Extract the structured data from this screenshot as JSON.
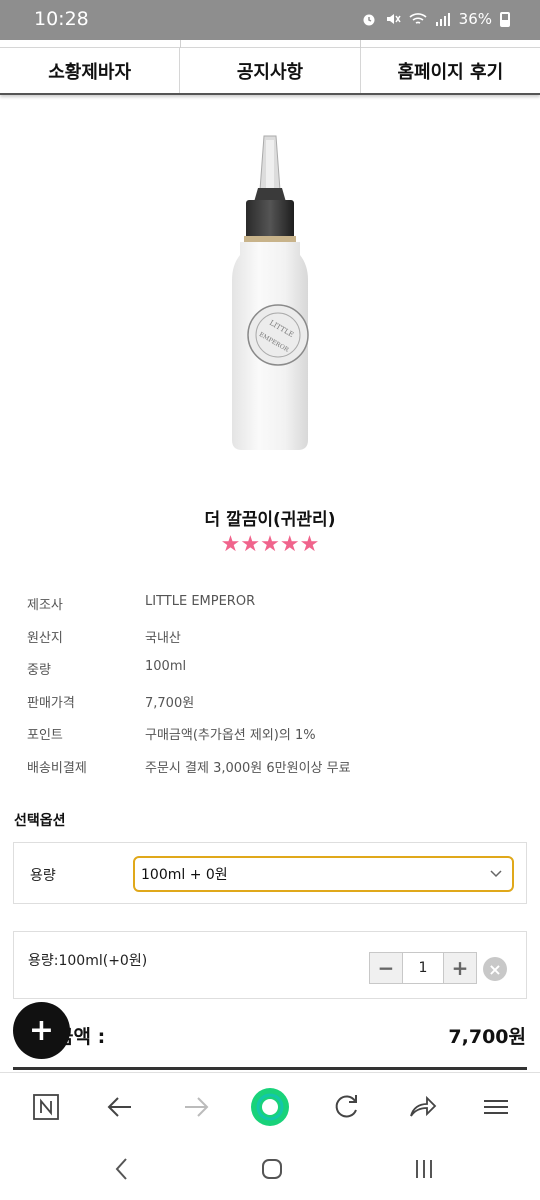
{
  "status": {
    "time": "10:28",
    "battery": "36%"
  },
  "nav": {
    "tabs": [
      "소황제바자",
      "공지사항",
      "홈페이지 후기"
    ]
  },
  "product": {
    "name": "더 깔끔이(귀관리)",
    "rating": 5,
    "bottle_label": "LITTLE EMPEROR",
    "info": [
      {
        "label": "제조사",
        "value": "LITTLE EMPEROR"
      },
      {
        "label": "원산지",
        "value": "국내산"
      },
      {
        "label": "중량",
        "value": "100ml"
      },
      {
        "label": "판매가격",
        "value": "7,700원"
      },
      {
        "label": "포인트",
        "value": "구매금액(추가옵션 제외)의 1%"
      },
      {
        "label": "배송비결제",
        "value": "주문시 결제 3,000원 6만원이상 무료"
      }
    ]
  },
  "options": {
    "title": "선택옵션",
    "label": "용량",
    "selected": "100ml  + 0원",
    "accent": "#e0a81a"
  },
  "cart_item": {
    "label": "용량:100ml(+0원)",
    "quantity": "1",
    "minus": "−",
    "plus": "+",
    "remove": "×"
  },
  "total": {
    "label": "금액 :",
    "value": "7,700원"
  },
  "fab": {
    "icon": "plus-icon",
    "label": "+"
  },
  "browser": {
    "icons": [
      "n-home-icon",
      "back-arrow-icon",
      "forward-arrow-icon",
      "naver-green-dot-icon",
      "refresh-icon",
      "share-icon",
      "menu-icon"
    ]
  },
  "colors": {
    "star": "#f0648c",
    "status_bar": "#8e8e8e",
    "green_dot": "#19d27a"
  }
}
